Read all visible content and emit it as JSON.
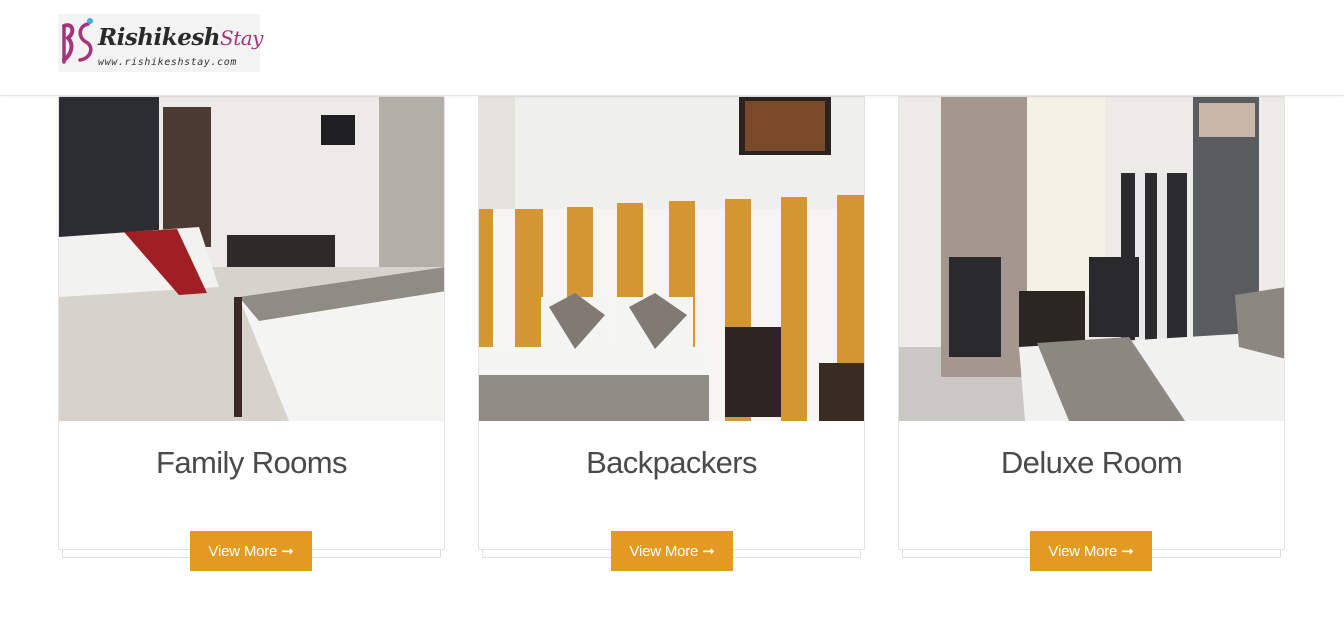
{
  "brand": {
    "name": "Rishikesh",
    "name_suffix": "Stay",
    "url": "www.rishikeshstay.com",
    "accent_color": "#a3357a"
  },
  "rooms": [
    {
      "title": "Family Rooms",
      "button_label": "View More",
      "button_icon": "arrow-right-icon"
    },
    {
      "title": "Backpackers",
      "button_label": "View More",
      "button_icon": "arrow-right-icon"
    },
    {
      "title": "Deluxe Room",
      "button_label": "View More",
      "button_icon": "arrow-right-icon"
    }
  ],
  "colors": {
    "button": "#e39a22",
    "title_text": "#4a4a4a"
  }
}
